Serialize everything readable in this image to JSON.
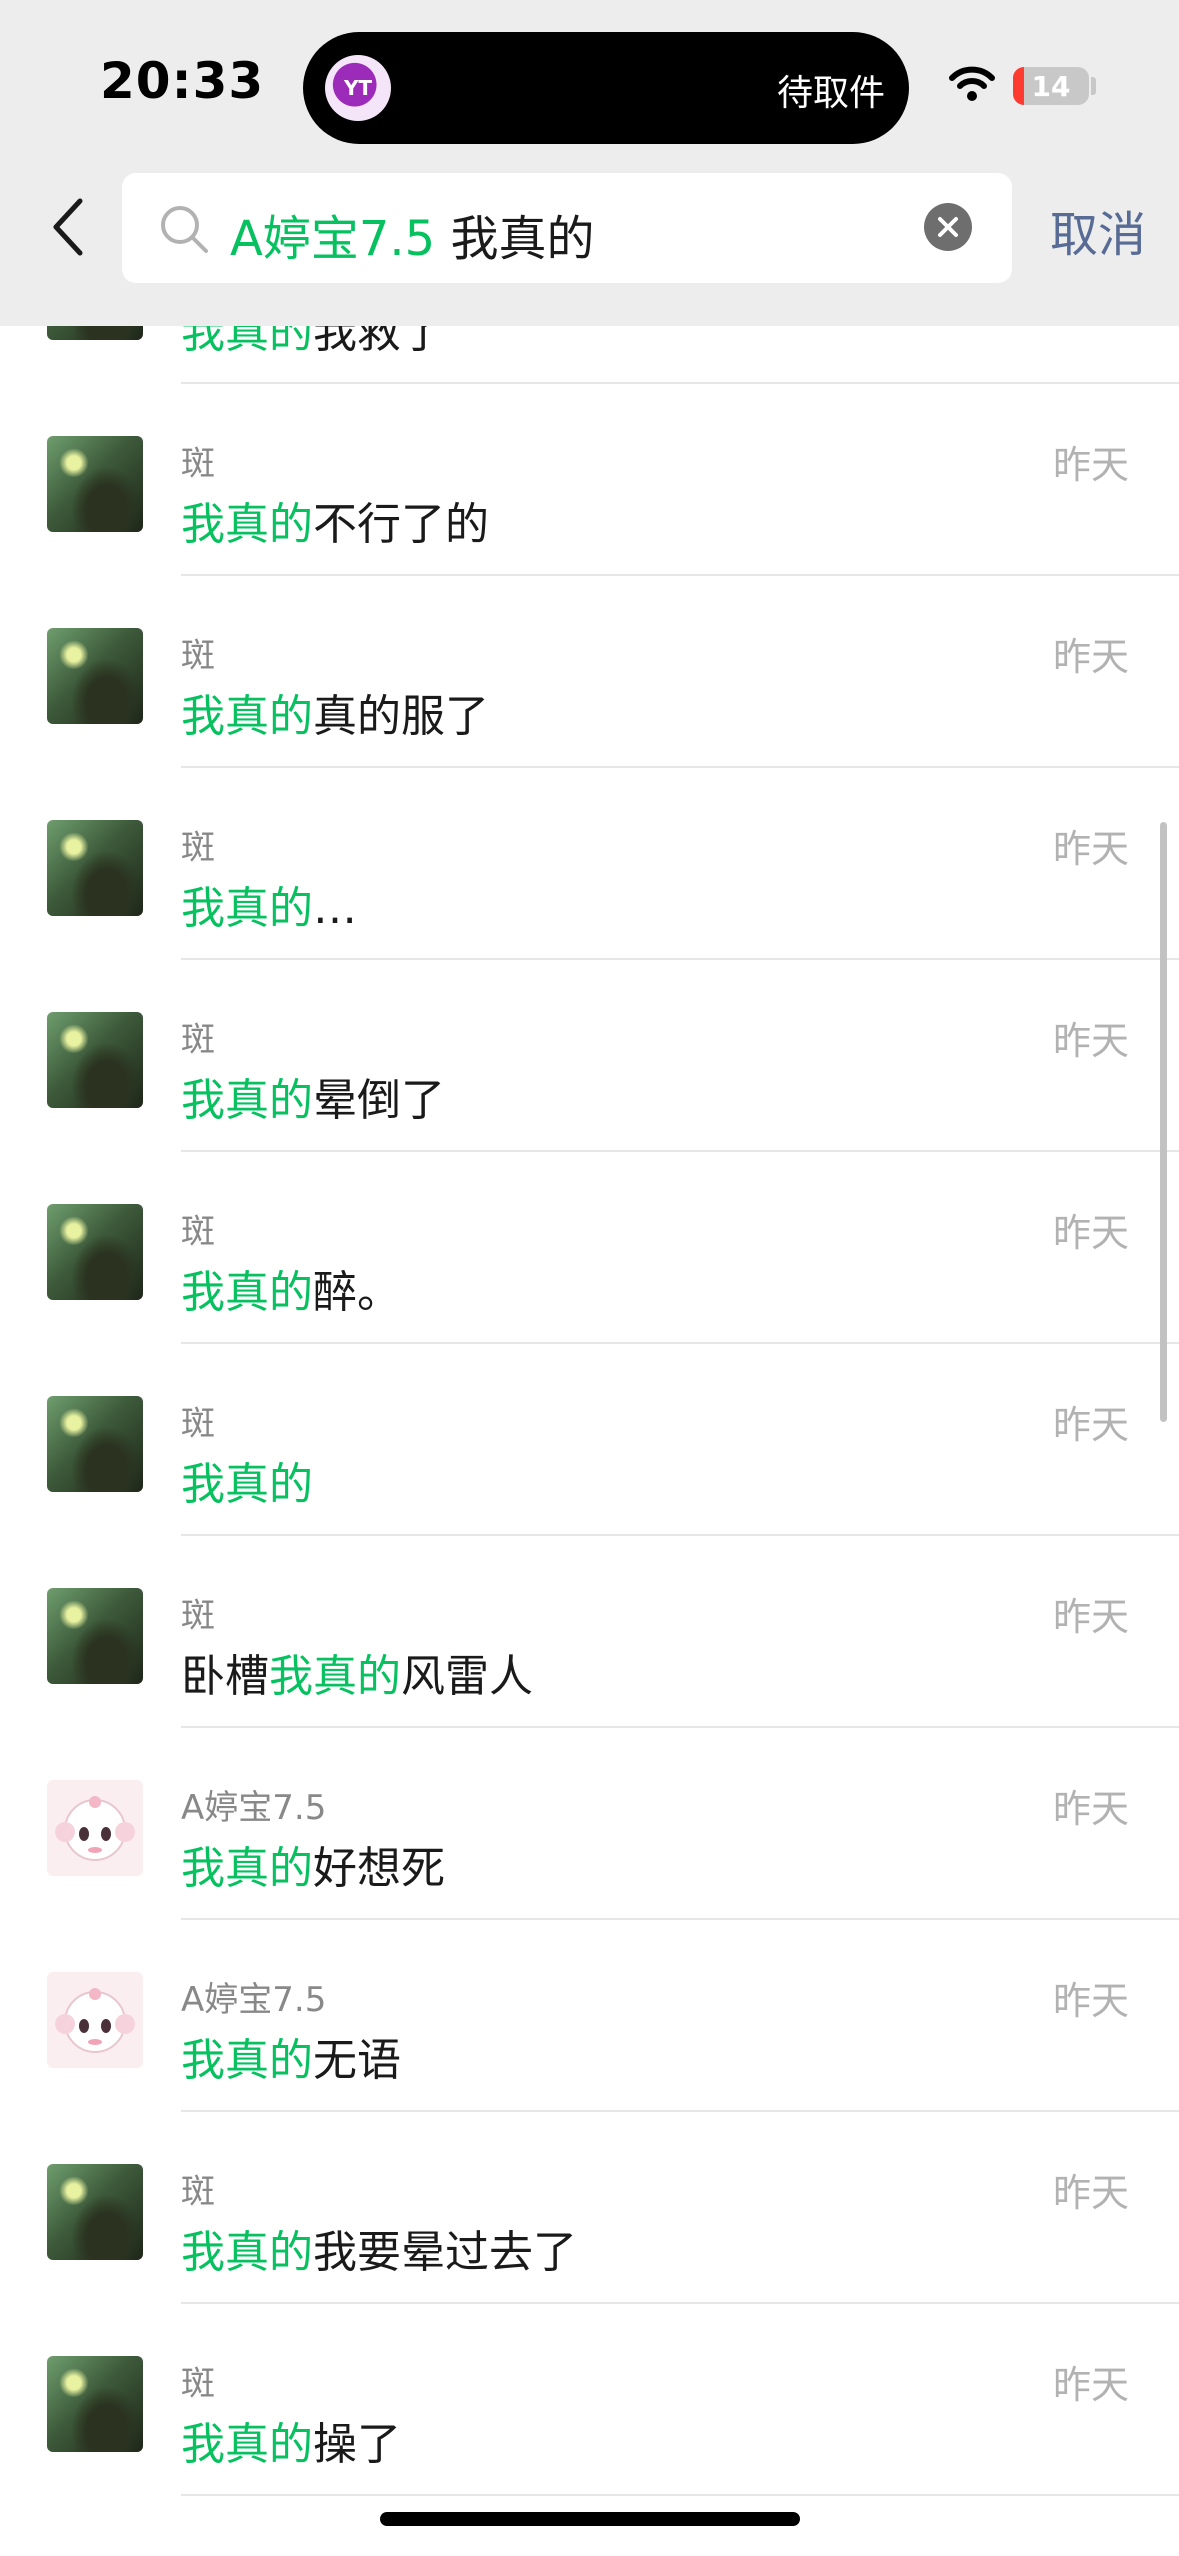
{
  "status_bar": {
    "time": "20:33",
    "island_label": "待取件",
    "island_logo_text": "YT",
    "battery_level": "14",
    "battery_fraction": 0.14
  },
  "search": {
    "contact": "A婷宝7.5",
    "keyword": "我真的",
    "cancel_label": "取消"
  },
  "results": [
    {
      "avatar": "photo",
      "sender": "",
      "time": "",
      "pre": "",
      "hl": "我真的",
      "post": "我救了"
    },
    {
      "avatar": "photo",
      "sender": "斑",
      "time": "昨天",
      "pre": "",
      "hl": "我真的",
      "post": "不行了的"
    },
    {
      "avatar": "photo",
      "sender": "斑",
      "time": "昨天",
      "pre": "",
      "hl": "我真的",
      "post": "真的服了"
    },
    {
      "avatar": "photo",
      "sender": "斑",
      "time": "昨天",
      "pre": "",
      "hl": "我真的",
      "post": "…"
    },
    {
      "avatar": "photo",
      "sender": "斑",
      "time": "昨天",
      "pre": "",
      "hl": "我真的",
      "post": "晕倒了"
    },
    {
      "avatar": "photo",
      "sender": "斑",
      "time": "昨天",
      "pre": "",
      "hl": "我真的",
      "post": "醉。"
    },
    {
      "avatar": "photo",
      "sender": "斑",
      "time": "昨天",
      "pre": "",
      "hl": "我真的",
      "post": ""
    },
    {
      "avatar": "photo",
      "sender": "斑",
      "time": "昨天",
      "pre": "卧槽",
      "hl": "我真的",
      "post": "风雷人"
    },
    {
      "avatar": "anime",
      "sender": "A婷宝7.5",
      "time": "昨天",
      "pre": "",
      "hl": "我真的",
      "post": "好想死"
    },
    {
      "avatar": "anime",
      "sender": "A婷宝7.5",
      "time": "昨天",
      "pre": "",
      "hl": "我真的",
      "post": "无语"
    },
    {
      "avatar": "photo",
      "sender": "斑",
      "time": "昨天",
      "pre": "",
      "hl": "我真的",
      "post": "我要晕过去了"
    },
    {
      "avatar": "photo",
      "sender": "斑",
      "time": "昨天",
      "pre": "",
      "hl": "我真的",
      "post": "操了"
    }
  ],
  "colors": {
    "highlight": "#07c160",
    "cancel": "#576b95",
    "header_bg": "#ededed",
    "battery_low": "#ff3b30"
  }
}
